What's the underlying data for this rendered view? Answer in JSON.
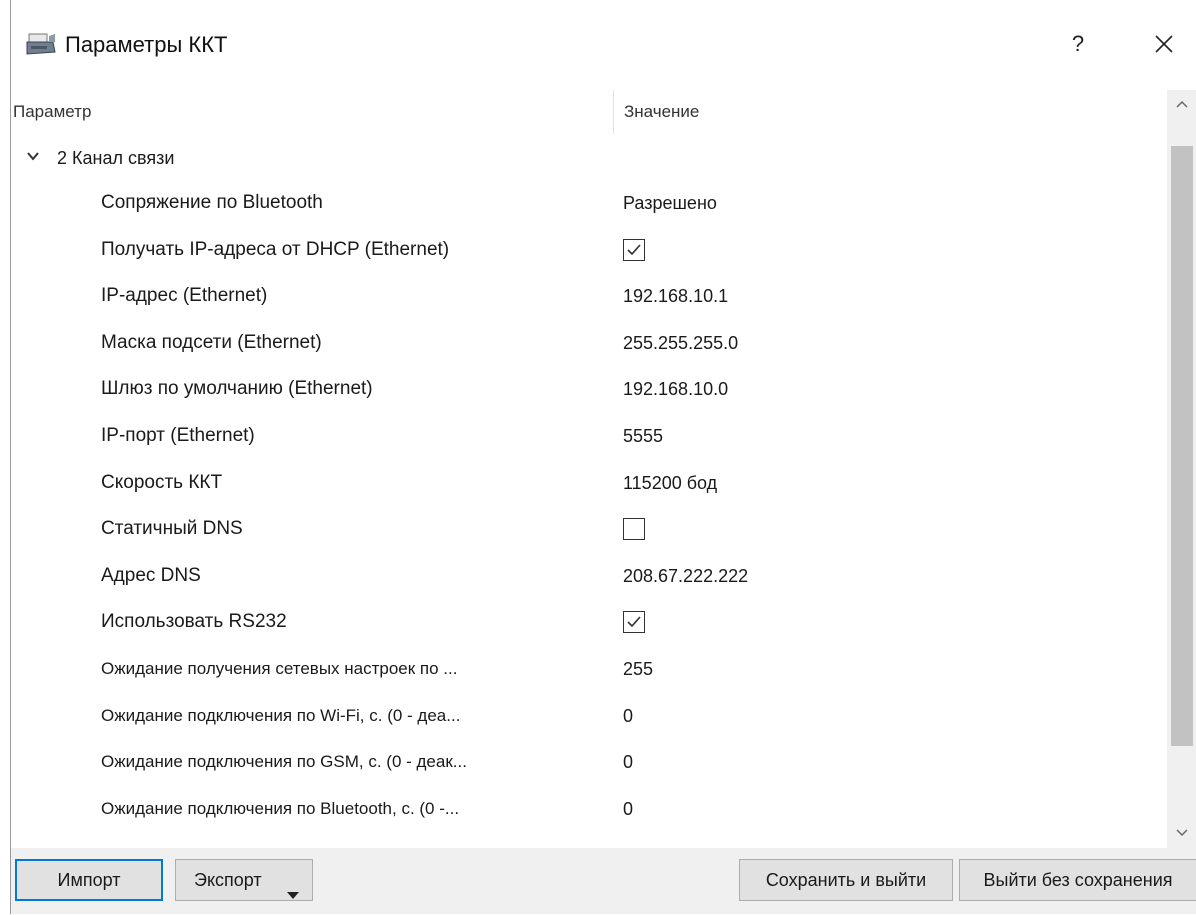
{
  "window": {
    "title": "Параметры ККТ",
    "help_label": "?"
  },
  "grid": {
    "col_param": "Параметр",
    "col_value": "Значение",
    "group": {
      "label": "2 Канал связи",
      "expanded": true
    },
    "rows": [
      {
        "param": "Сопряжение по Bluetooth",
        "value": "Разрешено"
      },
      {
        "param": "Получать IP-адреса от DHCP (Ethernet)",
        "checked": true
      },
      {
        "param": "IP-адрес (Ethernet)",
        "value": "192.168.10.1"
      },
      {
        "param": "Маска подсети (Ethernet)",
        "value": "255.255.255.0"
      },
      {
        "param": "Шлюз по умолчанию (Ethernet)",
        "value": "192.168.10.0"
      },
      {
        "param": "IP-порт (Ethernet)",
        "value": "5555"
      },
      {
        "param": "Скорость ККТ",
        "value": "115200 бод"
      },
      {
        "param": "Статичный DNS",
        "checked": false
      },
      {
        "param": "Адрес DNS",
        "value": "208.67.222.222"
      },
      {
        "param": "Использовать RS232",
        "checked": true
      },
      {
        "param": "Ожидание получения сетевых настроек по ...",
        "value": "255"
      },
      {
        "param": "Ожидание подключения по Wi-Fi, с. (0 - деа...",
        "value": "0"
      },
      {
        "param": "Ожидание подключения по GSM, с. (0 - деак...",
        "value": "0"
      },
      {
        "param": "Ожидание подключения по Bluetooth, с. (0 -...",
        "value": "0"
      }
    ]
  },
  "buttons": {
    "import": "Импорт",
    "export": "Экспорт",
    "save_exit": "Сохранить и выйти",
    "exit_no_save": "Выйти без сохранения"
  },
  "colors": {
    "focus_border": "#0078d7",
    "scroll_thumb": "#c2c2c2",
    "bottom_bar": "#f0f0f0"
  }
}
